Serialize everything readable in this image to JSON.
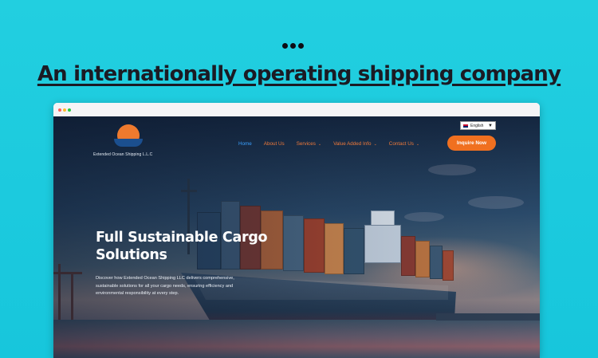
{
  "headline": "An internationally operating shipping company",
  "browser": {
    "site": {
      "brand_name": "Extended Ocean Shipping L.L.C",
      "language": {
        "flag_icon": "uk-flag-icon",
        "selected": "English",
        "caret_icon": "dropdown-caret-icon"
      },
      "nav": [
        {
          "label": "Home",
          "active": true
        },
        {
          "label": "About Us"
        },
        {
          "label": "Services",
          "has_dropdown": true
        },
        {
          "label": "Value Added Info",
          "has_dropdown": true
        },
        {
          "label": "Contact Us",
          "has_dropdown": true
        }
      ],
      "cta_label": "Inquire Now",
      "hero": {
        "title": "Full Sustainable Cargo Solutions",
        "description": "Discover how Extended Ocean Shipping LLC delivers comprehensive, sustainable solutions for all your cargo needs, ensuring efficiency and environmental responsibility at every step."
      }
    }
  },
  "colors": {
    "background": "#1ec9de",
    "accent_orange": "#f07020",
    "active_nav": "#3aa0ff",
    "headline_text": "#1b1b24"
  }
}
